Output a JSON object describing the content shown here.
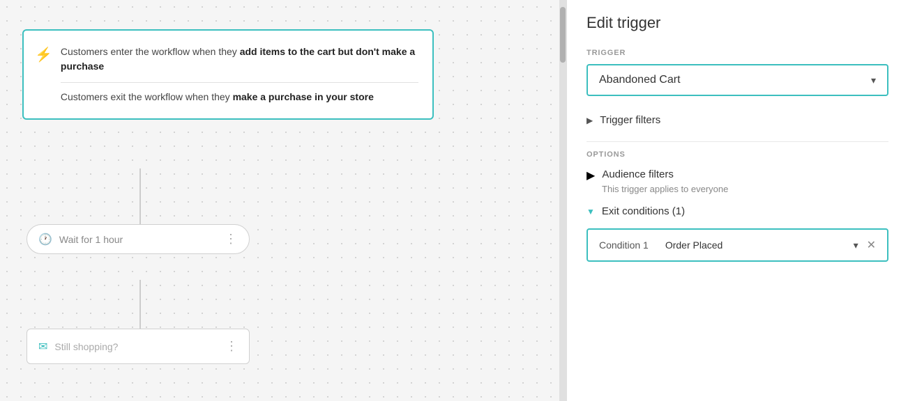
{
  "canvas": {
    "trigger_card": {
      "enter_text_prefix": "Customers enter the workflow when they ",
      "enter_text_bold": "add items to the cart but don't make a purchase",
      "exit_text_prefix": "Customers exit the workflow when they ",
      "exit_text_bold": "make a purchase in your store"
    },
    "wait_node": {
      "label": "Wait for 1 hour"
    },
    "email_node": {
      "label": "Still shopping?"
    }
  },
  "right_panel": {
    "title": "Edit trigger",
    "trigger_section_label": "TRIGGER",
    "trigger_value": "Abandoned Cart",
    "trigger_filters_label": "Trigger filters",
    "options_section_label": "OPTIONS",
    "audience_filters_label": "Audience filters",
    "audience_filters_sub": "This trigger applies to everyone",
    "exit_conditions_label": "Exit conditions (1)",
    "condition_label": "Condition 1",
    "condition_value": "Order Placed"
  }
}
